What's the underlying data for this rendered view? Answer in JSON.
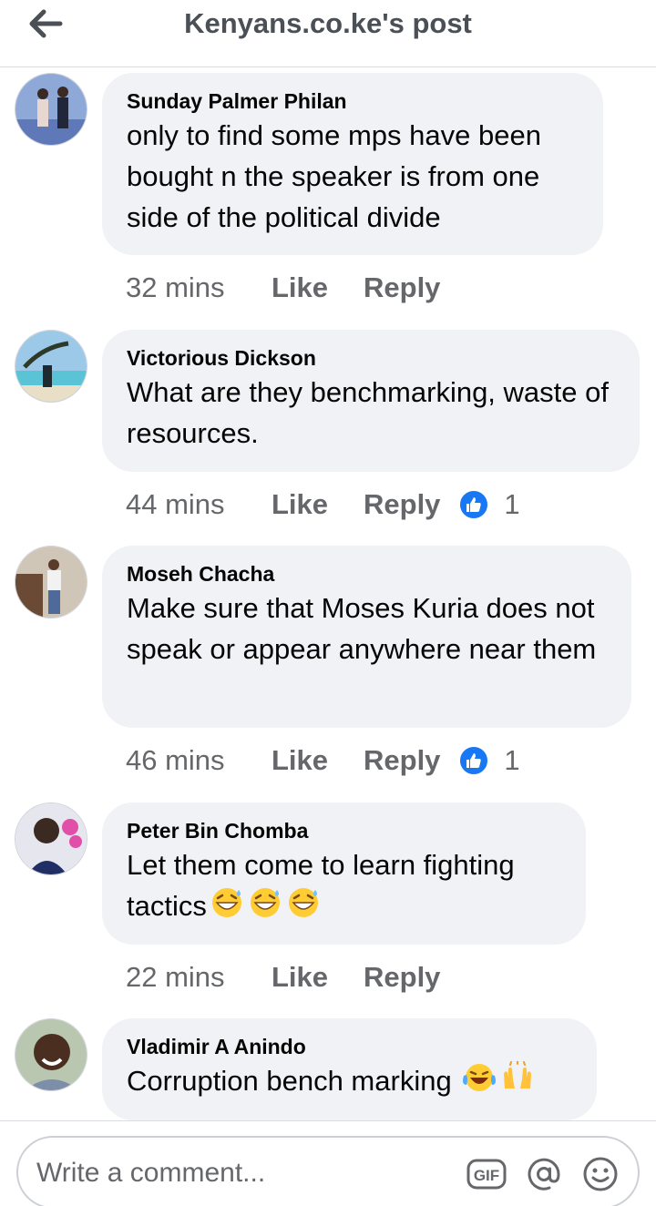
{
  "header": {
    "title": "Kenyans.co.ke's post",
    "back_icon": "arrow-left-icon"
  },
  "comments": [
    {
      "author": "Sunday Palmer Philan",
      "text": "only to find some mps have been bought n the speaker is from one side of the political divide",
      "time": "32 mins",
      "like_label": "Like",
      "reply_label": "Reply"
    },
    {
      "author": "Victorious Dickson",
      "text": "What are they benchmarking, waste of resources.",
      "time": "44 mins",
      "like_label": "Like",
      "reply_label": "Reply",
      "reactions": {
        "icon": "thumbs-up-icon",
        "count": "1"
      }
    },
    {
      "author": "Moseh Chacha",
      "text": "Make sure that Moses Kuria does not speak or appear anywhere near them",
      "time": "46 mins",
      "like_label": "Like",
      "reply_label": "Reply",
      "reactions": {
        "icon": "thumbs-up-icon",
        "count": "1"
      }
    },
    {
      "author": "Peter Bin Chomba",
      "text": "Let them come to learn fighting tactics",
      "emojis": [
        "grinning-sweat-emoji",
        "grinning-sweat-emoji",
        "grinning-sweat-emoji"
      ],
      "time": "22 mins",
      "like_label": "Like",
      "reply_label": "Reply"
    },
    {
      "author": "Vladimir A Anindo",
      "text": "Corruption bench marking",
      "emojis": [
        "tears-of-joy-emoji",
        "raised-hands-emoji"
      ]
    }
  ],
  "composer": {
    "placeholder": "Write a comment...",
    "gif_label": "GIF",
    "icons": [
      "gif-icon",
      "at-sign-icon",
      "smiley-icon"
    ]
  },
  "colors": {
    "bubble": "#f0f2f5",
    "meta": "#65676b",
    "accent": "#1877f2",
    "header_text": "#4b4f56"
  }
}
